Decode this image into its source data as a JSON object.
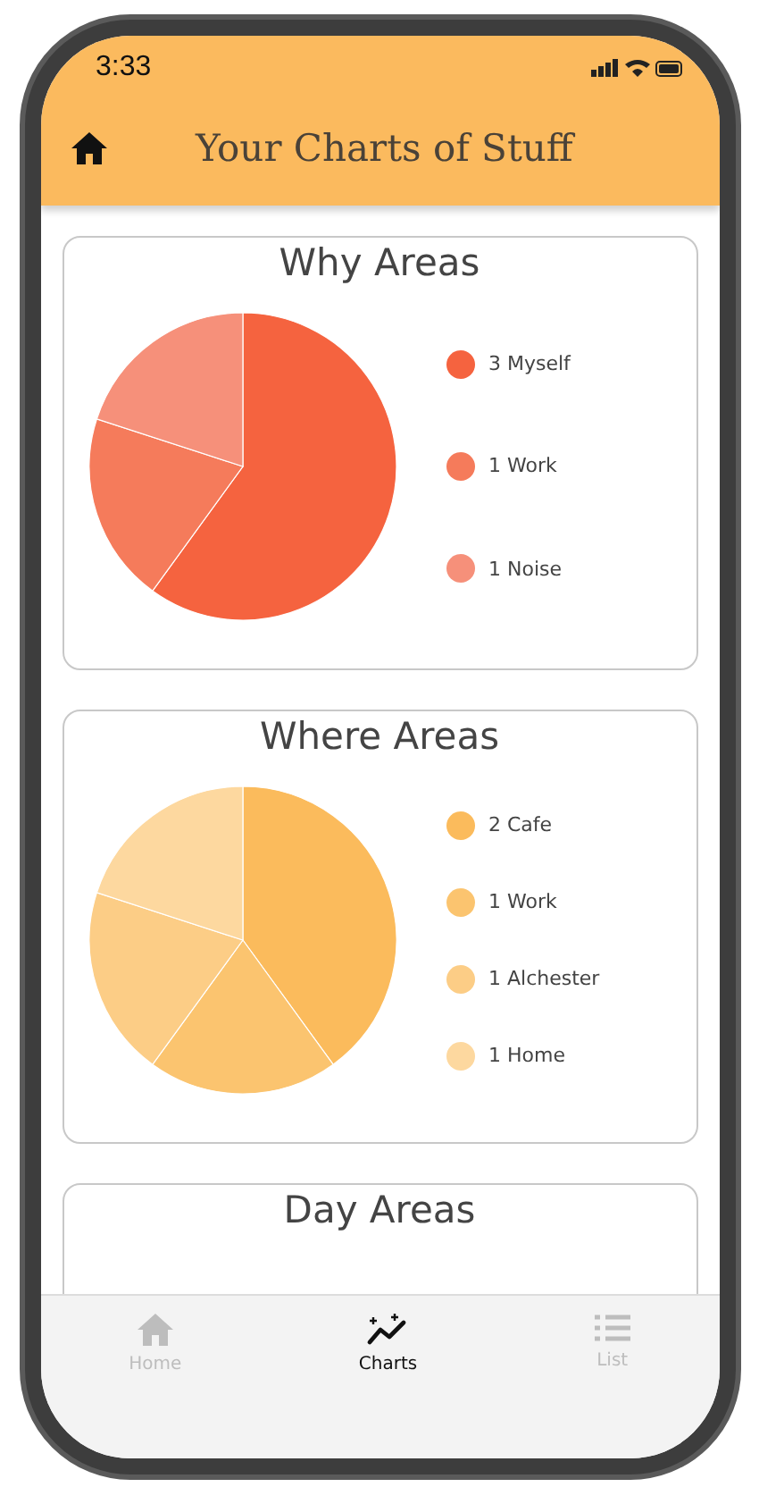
{
  "status_bar": {
    "time": "3:33"
  },
  "header": {
    "title": "Your Charts of Stuff"
  },
  "cards": [
    {
      "title": "Why Areas",
      "chart_data": {
        "type": "pie",
        "categories": [
          "3 Myself",
          "1 Work",
          "1 Noise"
        ],
        "values": [
          60,
          20,
          20
        ]
      },
      "legend": [
        {
          "color": "#f5633f"
        },
        {
          "color": "#f57b5b"
        },
        {
          "color": "#f6907a"
        }
      ]
    },
    {
      "title": "Where Areas",
      "chart_data": {
        "type": "pie",
        "categories": [
          "2 Cafe",
          "1 Work",
          "1 Alchester",
          "1 Home"
        ],
        "values": [
          40,
          20,
          20,
          20
        ]
      },
      "legend": [
        {
          "color": "#fbbb5c"
        },
        {
          "color": "#fbc46f"
        },
        {
          "color": "#fccd86"
        },
        {
          "color": "#fdd89f"
        }
      ]
    },
    {
      "title": "Day Areas"
    }
  ],
  "tab_bar": [
    {
      "label": "Home",
      "kind": "home",
      "selected": false
    },
    {
      "label": "Charts",
      "kind": "chart",
      "selected": true
    },
    {
      "label": "List",
      "kind": "list",
      "selected": false
    }
  ]
}
